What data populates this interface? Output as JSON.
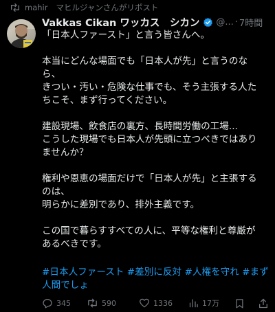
{
  "repost": {
    "user": "mahir",
    "suffix": "マヒルジャンさんがリポスト"
  },
  "post": {
    "display_name": "Vakkas Cikan ワッカス　シカン",
    "handle": "@...",
    "separator": "·",
    "time": "7時間",
    "lines": [
      "「日本人ファースト」と言う皆さんへ。",
      "",
      "本当にどんな場面でも「日本人が先」と言うのな",
      "ら、",
      "きつい・汚い・危険な仕事でも、そう主張する人た",
      "ちこそ、まず行ってください。",
      "",
      "建設現場、飲食店の裏方、長時間労働の工場...",
      "こうした現場でも日本人が先頭に立つべきではあり",
      "ませんか？",
      "",
      "権利や恩恵の場面だけで「日本人が先」と主張する",
      "のは、",
      "明らかに差別であり、排外主義です。",
      "",
      "この国で暮らすすべての人に、平等な権利と尊厳が",
      "あるべきです。"
    ],
    "hashtags": [
      "#日本人ファースト",
      "#差別に反対",
      "#人権を守れ",
      "#まず人間でしょ"
    ]
  },
  "actions": {
    "reply_count": "345",
    "repost_count": "590",
    "like_count": "1336",
    "views_count": "17万"
  },
  "icons": {
    "repost": "repost-icon",
    "verified": "verified-badge-icon",
    "reply": "reply-icon",
    "like": "heart-icon",
    "views": "views-chart-icon",
    "bookmark": "bookmark-icon",
    "share": "share-icon"
  },
  "colors": {
    "background": "#000000",
    "text": "#e7e9ea",
    "muted": "#71767b",
    "link": "#1d9bf0",
    "verified": "#1d9bf0"
  }
}
